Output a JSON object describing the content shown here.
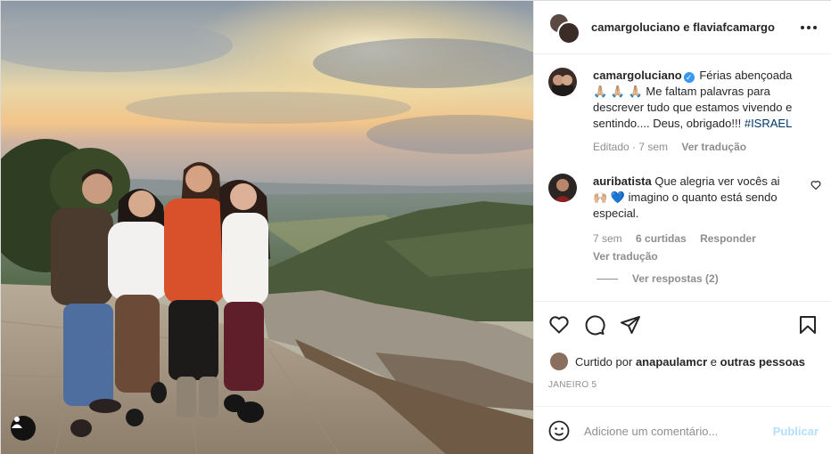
{
  "post": {
    "header": {
      "title": "camargoluciano e flaviafcamargo"
    },
    "caption": {
      "username": "camargoluciano",
      "verified_icon": "verified-badge-icon",
      "text_1": "Férias abençoada",
      "emojis_1": "🙏🏼 🙏🏼 🙏🏼",
      "text_2": "Me faltam palavras para descrever tudo que estamos vivendo e sentindo.... Deus, obrigado!!!",
      "hashtag": "#ISRAEL",
      "edited": "Editado · 7 sem",
      "see_translation": "Ver tradução"
    },
    "comment": {
      "username": "auribatista",
      "text_1": "Que alegria ver vocês ai",
      "emojis": "🙌🏼 💙",
      "text_2": "imagino o quanto está sendo especial.",
      "time": "7 sem",
      "likes": "6 curtidas",
      "reply": "Responder",
      "see_translation": "Ver tradução",
      "view_replies": "Ver respostas (2)"
    },
    "liked_by": {
      "prefix": "Curtido por",
      "user": "anapaulamcr",
      "connector": "e",
      "others": "outras pessoas"
    },
    "date": "JANEIRO 5",
    "add_comment": {
      "placeholder": "Adicione um comentário...",
      "publish": "Publicar"
    },
    "icons": [
      "heart-icon",
      "comment-icon",
      "share-icon",
      "bookmark-icon",
      "emoji-icon",
      "more-options-icon",
      "user-tag-icon"
    ],
    "colors": {
      "verified": "#3897f0",
      "hashtag": "#00376b",
      "publish": "#b2dffc",
      "muted": "#8e8e8e"
    }
  }
}
